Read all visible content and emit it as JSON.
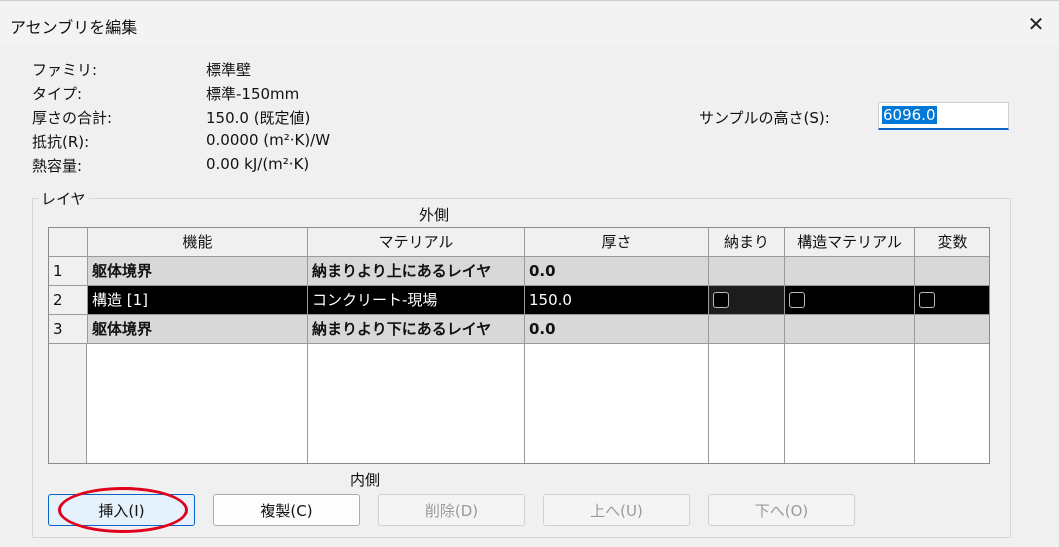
{
  "window": {
    "title": "アセンブリを編集",
    "close_glyph": "✕"
  },
  "properties": [
    {
      "label": "ファミリ:",
      "value": "標準壁"
    },
    {
      "label": "タイプ:",
      "value": "標準-150mm"
    },
    {
      "label": "厚さの合計:",
      "value": "150.0 (既定値)"
    },
    {
      "label": "抵抗(R):",
      "value": "0.0000 (m²·K)/W"
    },
    {
      "label": "熱容量:",
      "value": "0.00 kJ/(m²·K)"
    }
  ],
  "sample": {
    "label": "サンプルの高さ(S):",
    "value": "6096.0"
  },
  "layers": {
    "legend": "レイヤ",
    "outer_label": "外側",
    "inner_label": "内側",
    "columns": [
      "",
      "機能",
      "マテリアル",
      "厚さ",
      "納まり",
      "構造マテリアル",
      "変数"
    ],
    "rows": [
      {
        "num": "1",
        "function": "躯体境界",
        "material": "納まりより上にあるレイヤ",
        "thickness": "0.0"
      },
      {
        "num": "2",
        "function": "構造 [1]",
        "material": "コンクリート-現場",
        "thickness": "150.0",
        "wraps": false,
        "structural": false,
        "variable": false
      },
      {
        "num": "3",
        "function": "躯体境界",
        "material": "納まりより下にあるレイヤ",
        "thickness": "0.0"
      }
    ]
  },
  "buttons": {
    "insert": "挿入(I)",
    "duplicate": "複製(C)",
    "delete": "削除(D)",
    "up": "上へ(U)",
    "down": "下へ(O)"
  },
  "colors": {
    "selection": "#000000",
    "boundary_row": "#d8d8d8",
    "annotation": "#e0001b",
    "focus": "#0a64c8"
  }
}
